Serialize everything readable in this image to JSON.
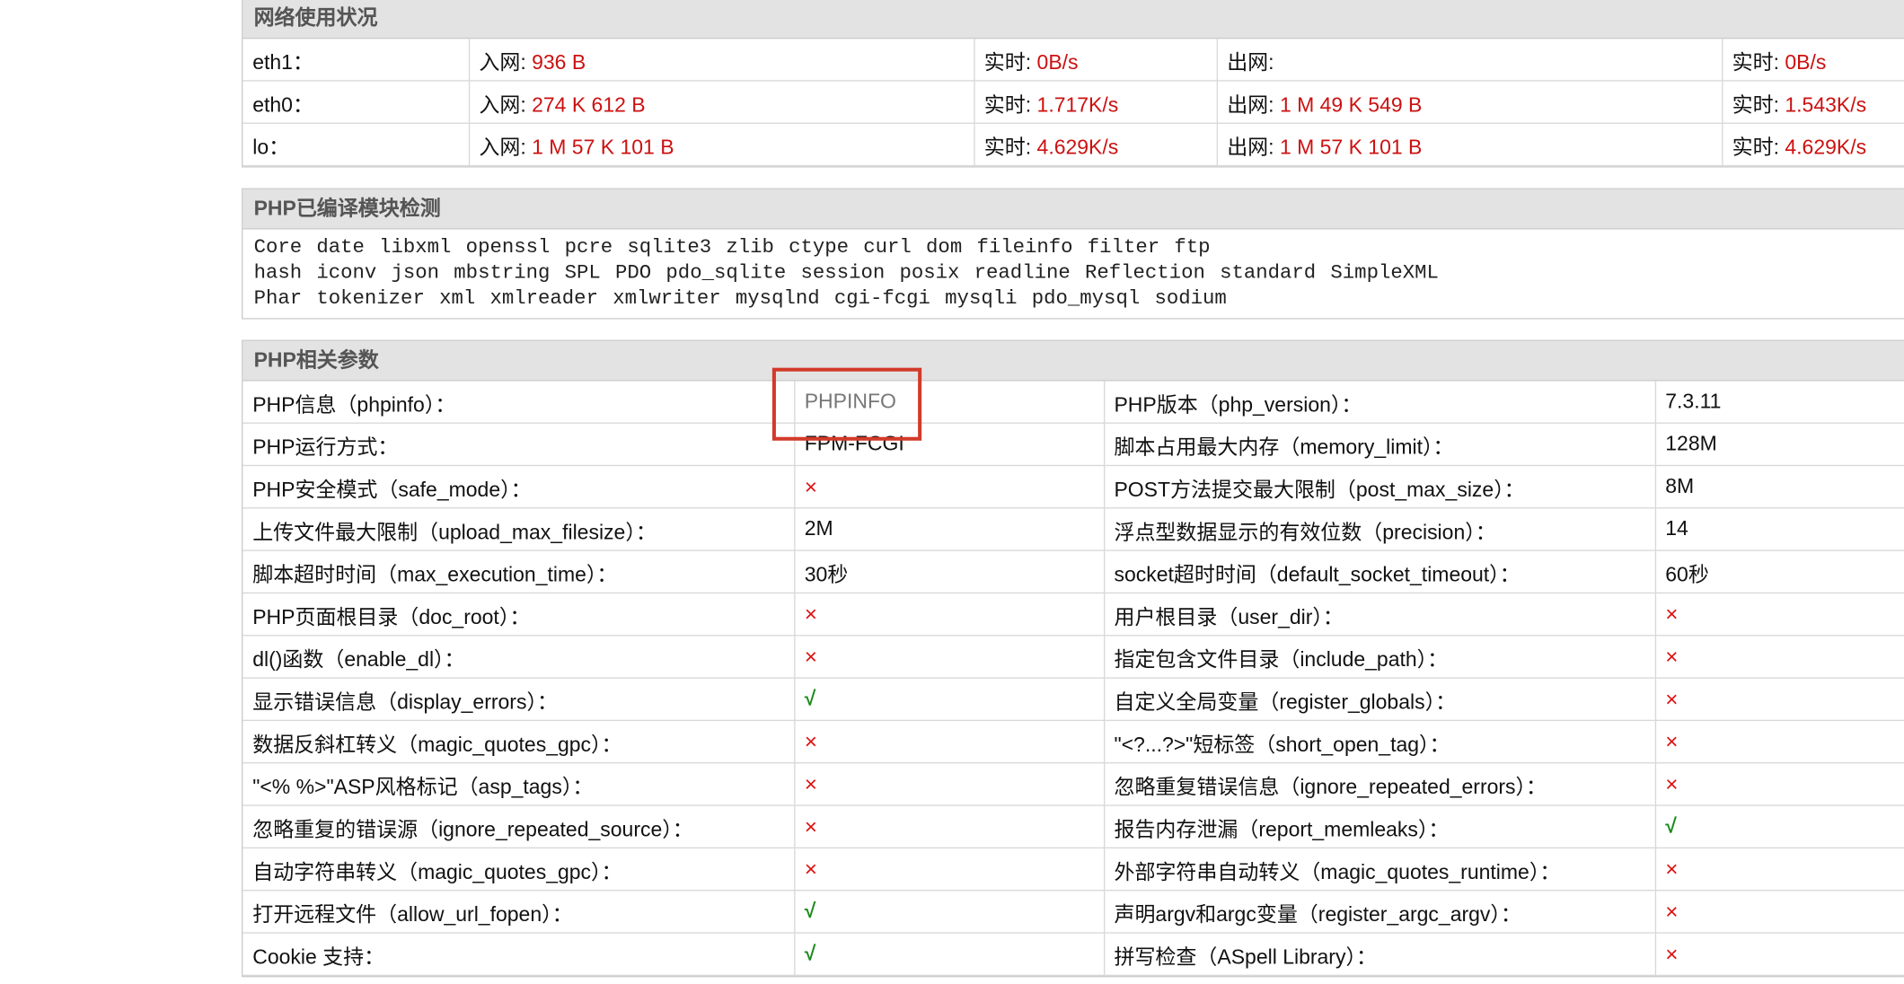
{
  "network": {
    "title": "网络使用状况",
    "rows": [
      {
        "iface": "eth1：",
        "in_label": "入网: ",
        "in_value": "936 B",
        "rt_label": "实时: ",
        "rt_in": "0B/s",
        "out_label": "出网: ",
        "out_value": "",
        "rt2_label": "实时: ",
        "rt_out": "0B/s"
      },
      {
        "iface": "eth0：",
        "in_label": "入网: ",
        "in_value": "274 K 612 B",
        "rt_label": "实时: ",
        "rt_in": "1.717K/s",
        "out_label": "出网: ",
        "out_value": "1 M 49 K 549 B",
        "rt2_label": "实时: ",
        "rt_out": "1.543K/s"
      },
      {
        "iface": "lo：",
        "in_label": "入网: ",
        "in_value": "1 M 57 K 101 B",
        "rt_label": "实时: ",
        "rt_in": "4.629K/s",
        "out_label": "出网: ",
        "out_value": "1 M 57 K 101 B",
        "rt2_label": "实时: ",
        "rt_out": "4.629K/s"
      }
    ]
  },
  "modules": {
    "title": "PHP已编译模块检测",
    "lines": [
      [
        "Core",
        "date",
        "libxml",
        "openssl",
        "pcre",
        "sqlite3",
        "zlib",
        "ctype",
        "curl",
        "dom",
        "fileinfo",
        "filter",
        "ftp"
      ],
      [
        "hash",
        "iconv",
        "json",
        "mbstring",
        "SPL",
        "PDO",
        "pdo_sqlite",
        "session",
        "posix",
        "readline",
        "Reflection",
        "standard",
        "SimpleXML"
      ],
      [
        "Phar",
        "tokenizer",
        "xml",
        "xmlreader",
        "xmlwriter",
        "mysqlnd",
        "cgi-fcgi",
        "mysqli",
        "pdo_mysql",
        "sodium"
      ]
    ]
  },
  "params": {
    "title": "PHP相关参数",
    "rows": [
      {
        "l_label": "PHP信息（phpinfo）：",
        "l_value": "PHPINFO",
        "l_type": "link",
        "r_label": "PHP版本（php_version）：",
        "r_value": "7.3.11",
        "r_type": "text"
      },
      {
        "l_label": "PHP运行方式：",
        "l_value": "FPM-FCGI",
        "l_type": "text",
        "r_label": "脚本占用最大内存（memory_limit）：",
        "r_value": "128M",
        "r_type": "text"
      },
      {
        "l_label": "PHP安全模式（safe_mode）：",
        "l_value": "×",
        "l_type": "cross",
        "r_label": "POST方法提交最大限制（post_max_size）：",
        "r_value": "8M",
        "r_type": "text"
      },
      {
        "l_label": "上传文件最大限制（upload_max_filesize）：",
        "l_value": "2M",
        "l_type": "text",
        "r_label": "浮点型数据显示的有效位数（precision）：",
        "r_value": "14",
        "r_type": "text"
      },
      {
        "l_label": "脚本超时时间（max_execution_time）：",
        "l_value": "30秒",
        "l_type": "text",
        "r_label": "socket超时时间（default_socket_timeout）：",
        "r_value": "60秒",
        "r_type": "text"
      },
      {
        "l_label": "PHP页面根目录（doc_root）：",
        "l_value": "×",
        "l_type": "cross",
        "r_label": "用户根目录（user_dir）：",
        "r_value": "×",
        "r_type": "cross"
      },
      {
        "l_label": "dl()函数（enable_dl）：",
        "l_value": "×",
        "l_type": "cross",
        "r_label": "指定包含文件目录（include_path）：",
        "r_value": "×",
        "r_type": "cross"
      },
      {
        "l_label": "显示错误信息（display_errors）：",
        "l_value": "√",
        "l_type": "check",
        "r_label": "自定义全局变量（register_globals）：",
        "r_value": "×",
        "r_type": "cross"
      },
      {
        "l_label": "数据反斜杠转义（magic_quotes_gpc）：",
        "l_value": "×",
        "l_type": "cross",
        "r_label": "\"<?...?>\"短标签（short_open_tag）：",
        "r_value": "×",
        "r_type": "cross"
      },
      {
        "l_label": "\"<% %>\"ASP风格标记（asp_tags）：",
        "l_value": "×",
        "l_type": "cross",
        "r_label": "忽略重复错误信息（ignore_repeated_errors）：",
        "r_value": "×",
        "r_type": "cross"
      },
      {
        "l_label": "忽略重复的错误源（ignore_repeated_source）：",
        "l_value": "×",
        "l_type": "cross",
        "r_label": "报告内存泄漏（report_memleaks）：",
        "r_value": "√",
        "r_type": "check"
      },
      {
        "l_label": "自动字符串转义（magic_quotes_gpc）：",
        "l_value": "×",
        "l_type": "cross",
        "r_label": "外部字符串自动转义（magic_quotes_runtime）：",
        "r_value": "×",
        "r_type": "cross"
      },
      {
        "l_label": "打开远程文件（allow_url_fopen）：",
        "l_value": "√",
        "l_type": "check",
        "r_label": "声明argv和argc变量（register_argc_argv）：",
        "r_value": "×",
        "r_type": "cross"
      },
      {
        "l_label": "Cookie 支持：",
        "l_value": "√",
        "l_type": "check",
        "r_label": "拼写检查（ASpell Library）：",
        "r_value": "×",
        "r_type": "cross"
      }
    ]
  },
  "colors": {
    "value_red": "#cc1111",
    "check_green": "#1a8a1a",
    "highlight_box": "#d23a2a"
  }
}
